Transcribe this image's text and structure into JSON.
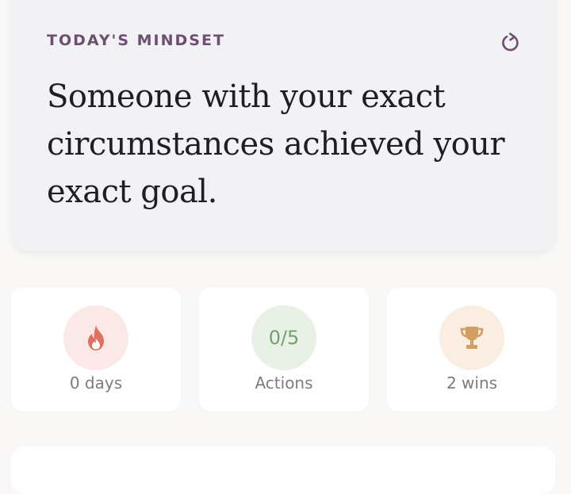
{
  "mindset": {
    "label": "TODAY'S MINDSET",
    "quote": "Someone with your exact circumstances achieved your exact goal.",
    "refresh_icon": "refresh-icon",
    "label_color": "#6d4f72"
  },
  "stats": {
    "streak": {
      "icon": "flame-icon",
      "label": "0 days",
      "icon_color": "#e0715e",
      "circle_color": "#fae9e6"
    },
    "actions": {
      "value": "0/5",
      "label": "Actions",
      "value_color": "#73a06e",
      "circle_color": "#e9f0e6"
    },
    "wins": {
      "icon": "trophy-icon",
      "label": "2 wins",
      "icon_color": "#d49d63",
      "circle_color": "#faeee3"
    }
  }
}
